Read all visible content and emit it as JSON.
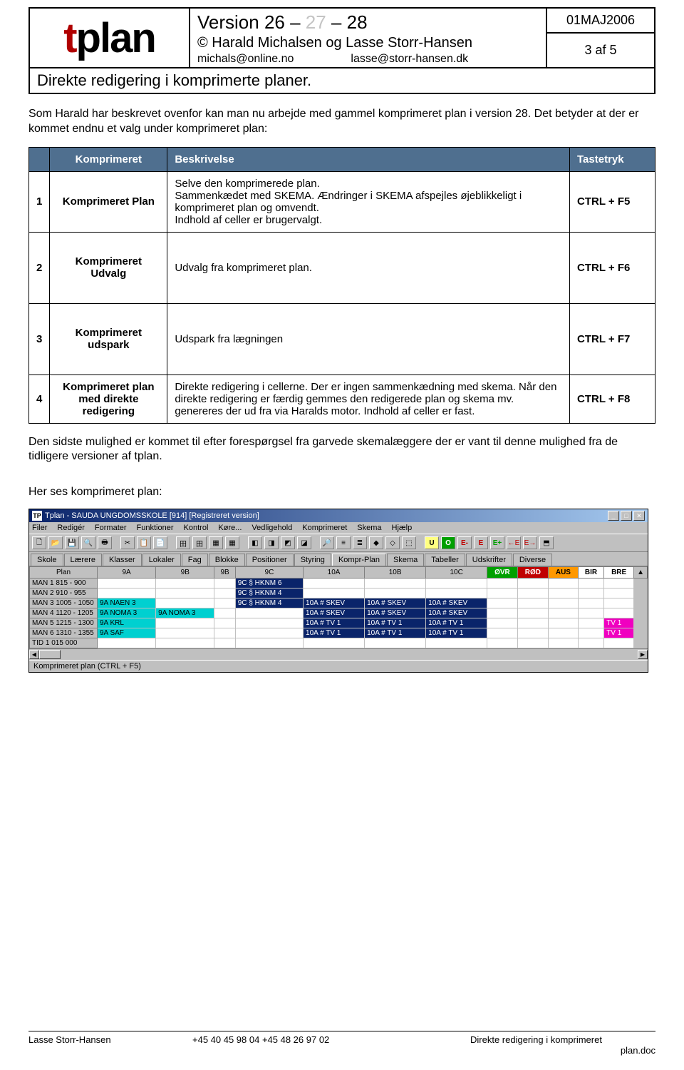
{
  "header": {
    "logo_t": "t",
    "logo_plan": "plan",
    "version_pre": "Version 26 – ",
    "version_27": "27",
    "version_post": " – 28",
    "copyright": "© Harald Michalsen  og  Lasse Storr-Hansen",
    "email1": "michals@online.no",
    "email2": "lasse@storr-hansen.dk",
    "date": "01MAJ2006",
    "pageno": "3 af 5",
    "doc_title": "Direkte redigering i komprimerte planer."
  },
  "intro": "Som Harald har beskrevet ovenfor kan man nu arbejde med gammel komprimeret plan i version 28. Det betyder at der er kommet endnu et valg under komprimeret plan:",
  "table": {
    "headers": {
      "c1": "",
      "c2": "Komprimeret",
      "c3": "Beskrivelse",
      "c4": "Tastetryk"
    },
    "rows": [
      {
        "n": "1",
        "name": "Komprimeret Plan",
        "desc": "Selve den komprimerede plan.\nSammenkædet med SKEMA. Ændringer i SKEMA afspejles øjeblikkeligt i komprimeret plan og omvendt.\nIndhold af celler er brugervalgt.",
        "key": "CTRL + F5"
      },
      {
        "n": "2",
        "name": "Komprimeret Udvalg",
        "desc": "Udvalg fra komprimeret plan.",
        "key": "CTRL + F6"
      },
      {
        "n": "3",
        "name": "Komprimeret udspark",
        "desc": "Udspark fra lægningen",
        "key": "CTRL + F7"
      },
      {
        "n": "4",
        "name": "Komprimeret plan med direkte redigering",
        "desc": "Direkte redigering i cellerne. Der er ingen sammenkædning med skema. Når den direkte redigering er færdig gemmes den redigerede plan og skema mv. genereres der ud fra via Haralds motor. Indhold af celler er fast.",
        "key": "CTRL + F8"
      }
    ]
  },
  "after_table": "Den sidste mulighed er kommet til efter forespørgsel fra garvede skemalæggere der er vant til denne mulighed fra de tidligere versioner af tplan.",
  "section_label": "Her ses komprimeret plan:",
  "screenshot": {
    "title": "Tplan - SAUDA UNGDOMSSKOLE [914]   [Registreret version]",
    "menu": [
      "Filer",
      "Redigér",
      "Formater",
      "Funktioner",
      "Kontrol",
      "Køre...",
      "Vedligehold",
      "Komprimeret",
      "Skema",
      "Hjælp"
    ],
    "tabs": [
      "Skole",
      "Lærere",
      "Klasser",
      "Lokaler",
      "Fag",
      "Blokke",
      "Positioner",
      "Styring",
      "Kompr-Plan",
      "Skema",
      "Tabeller",
      "Udskrifter",
      "Diverse"
    ],
    "active_tab": 8,
    "col_headers_left": [
      "Plan"
    ],
    "cols": [
      "9A",
      "9B",
      "9B",
      "9C",
      "10A",
      "10B",
      "10C"
    ],
    "col_headers_right": [
      "ØVR",
      "RØD",
      "AUS",
      "BIR",
      "BRE"
    ],
    "rows": [
      {
        "h": "MAN 1  815 - 900",
        "c": [
          "",
          "",
          "",
          "9C § HKNM 6",
          "",
          "",
          "",
          "",
          "",
          "",
          "",
          ""
        ]
      },
      {
        "h": "MAN 2  910 - 955",
        "c": [
          "",
          "",
          "",
          "9C § HKNM 4",
          "",
          "",
          "",
          "",
          "",
          "",
          "",
          ""
        ]
      },
      {
        "h": "MAN 3 1005 - 1050",
        "c": [
          "9A  NAEN 3",
          "",
          "",
          "9C § HKNM 4",
          "10A # SKEV",
          "10A # SKEV",
          "10A # SKEV",
          "",
          "",
          "",
          "",
          ""
        ]
      },
      {
        "h": "MAN 4 1120 - 1205",
        "c": [
          "9A  NOMA 3",
          "9A  NOMA 3",
          "",
          "",
          "10A # SKEV",
          "10A # SKEV",
          "10A # SKEV",
          "",
          "",
          "",
          "",
          ""
        ]
      },
      {
        "h": "MAN 5 1215 - 1300",
        "c": [
          "9A  KRL",
          "",
          "",
          "",
          "10A # TV  1",
          "10A # TV  1",
          "10A # TV  1",
          "",
          "",
          "",
          "",
          "TV  1"
        ]
      },
      {
        "h": "MAN 6 1310 - 1355",
        "c": [
          "9A  SAF",
          "",
          "",
          "",
          "10A # TV  1",
          "10A # TV  1",
          "10A # TV  1",
          "",
          "",
          "",
          "",
          "TV  1"
        ]
      },
      {
        "h": "TID  1   015   000",
        "c": [
          "",
          "",
          "",
          "",
          "",
          "",
          "",
          "",
          "",
          "",
          "",
          ""
        ]
      }
    ],
    "statusbar": "Komprimeret plan (CTRL + F5)"
  },
  "footer": {
    "left": "Lasse Storr-Hansen",
    "mid": "+45 40 45 98 04   +45 48 26 97 02",
    "right1": "Direkte redigering i komprimeret",
    "right2": "plan.doc"
  },
  "icons": {
    "close": "✕",
    "min": "_",
    "max": "□",
    "restore": "❐",
    "new": "🗋",
    "open": "📂",
    "save": "💾",
    "print": "🖶",
    "preview": "🔍",
    "zoom": "🔎"
  }
}
